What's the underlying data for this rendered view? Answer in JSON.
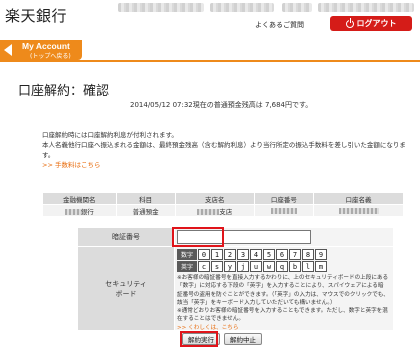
{
  "header": {
    "brand": "楽天銀行",
    "faq_label": "よくあるご質問",
    "logout_label": "ログアウト"
  },
  "my_account": {
    "title": "My Account",
    "subtitle": "(トップへ戻る)"
  },
  "page": {
    "title": "口座解約：確認",
    "balance_line": "2014/05/12 07:32現在の普通預金残高は 7,684円です。"
  },
  "notice": {
    "line1": "口座解約時には口座解約利息が付利されます。",
    "line2": "本人名義他行口座へ振込まれる金額は、最終預金残高（含む解約利息）より当行所定の振込手数料を差し引いた金額になります。",
    "fee_link": ">> 手数料はこちら"
  },
  "account_table": {
    "headers": [
      "金融機関名",
      "科目",
      "支店名",
      "口座番号",
      "口座名義"
    ],
    "row": {
      "bank_suffix": "銀行",
      "type": "普通預金",
      "branch_suffix": "支店"
    }
  },
  "form": {
    "pin_label": "暗証番号",
    "pin_value": "",
    "security_label_1": "セキュリティ",
    "security_label_2": "ボード",
    "digits_label": "数字",
    "digits": [
      "0",
      "1",
      "2",
      "3",
      "4",
      "5",
      "6",
      "7",
      "8",
      "9"
    ],
    "letters_label": "英字",
    "letters": [
      "c",
      "s",
      "y",
      "j",
      "u",
      "w",
      "q",
      "b",
      "l",
      "m"
    ],
    "help_text": "※お客様の暗証番号を直接入力するかわりに、上のセキュリティボードの上段にある「数字」に対応する下段の「英字」を入力することにより、スパイウェアによる暗証番号の盗用を防ぐことができます。（「英字」の入力は、マウスでのクリックでも、該当「英字」をキーボード入力していただいても構いません。）",
    "help_text_2": "※通常どおりお客様の暗証番号を入力することもできます。ただし、数字と英字を混在することはできません。",
    "details_link": ">> くわしくは、こちら",
    "execute_label": "解約実行",
    "cancel_label": "解約中止"
  }
}
